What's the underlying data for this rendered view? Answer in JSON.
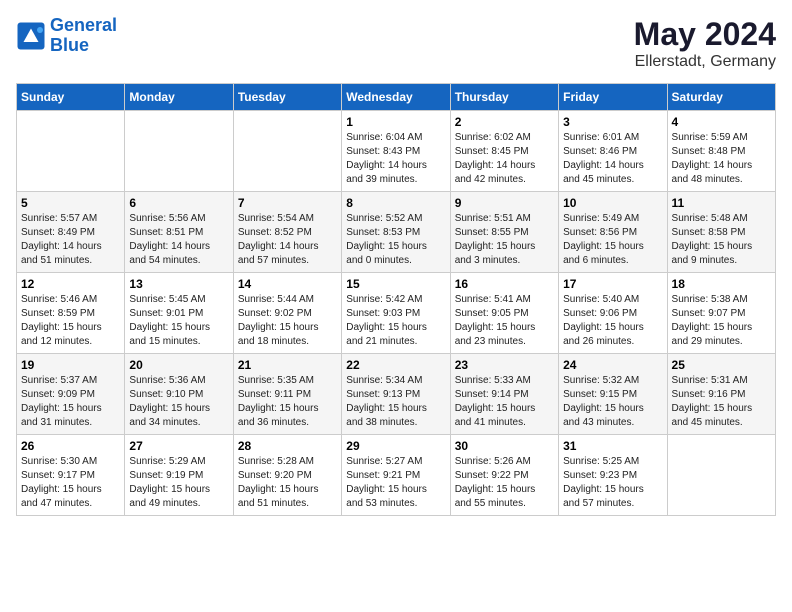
{
  "logo": {
    "line1": "General",
    "line2": "Blue"
  },
  "title": "May 2024",
  "subtitle": "Ellerstadt, Germany",
  "weekdays": [
    "Sunday",
    "Monday",
    "Tuesday",
    "Wednesday",
    "Thursday",
    "Friday",
    "Saturday"
  ],
  "weeks": [
    [
      {
        "day": "",
        "detail": ""
      },
      {
        "day": "",
        "detail": ""
      },
      {
        "day": "",
        "detail": ""
      },
      {
        "day": "1",
        "detail": "Sunrise: 6:04 AM\nSunset: 8:43 PM\nDaylight: 14 hours\nand 39 minutes."
      },
      {
        "day": "2",
        "detail": "Sunrise: 6:02 AM\nSunset: 8:45 PM\nDaylight: 14 hours\nand 42 minutes."
      },
      {
        "day": "3",
        "detail": "Sunrise: 6:01 AM\nSunset: 8:46 PM\nDaylight: 14 hours\nand 45 minutes."
      },
      {
        "day": "4",
        "detail": "Sunrise: 5:59 AM\nSunset: 8:48 PM\nDaylight: 14 hours\nand 48 minutes."
      }
    ],
    [
      {
        "day": "5",
        "detail": "Sunrise: 5:57 AM\nSunset: 8:49 PM\nDaylight: 14 hours\nand 51 minutes."
      },
      {
        "day": "6",
        "detail": "Sunrise: 5:56 AM\nSunset: 8:51 PM\nDaylight: 14 hours\nand 54 minutes."
      },
      {
        "day": "7",
        "detail": "Sunrise: 5:54 AM\nSunset: 8:52 PM\nDaylight: 14 hours\nand 57 minutes."
      },
      {
        "day": "8",
        "detail": "Sunrise: 5:52 AM\nSunset: 8:53 PM\nDaylight: 15 hours\nand 0 minutes."
      },
      {
        "day": "9",
        "detail": "Sunrise: 5:51 AM\nSunset: 8:55 PM\nDaylight: 15 hours\nand 3 minutes."
      },
      {
        "day": "10",
        "detail": "Sunrise: 5:49 AM\nSunset: 8:56 PM\nDaylight: 15 hours\nand 6 minutes."
      },
      {
        "day": "11",
        "detail": "Sunrise: 5:48 AM\nSunset: 8:58 PM\nDaylight: 15 hours\nand 9 minutes."
      }
    ],
    [
      {
        "day": "12",
        "detail": "Sunrise: 5:46 AM\nSunset: 8:59 PM\nDaylight: 15 hours\nand 12 minutes."
      },
      {
        "day": "13",
        "detail": "Sunrise: 5:45 AM\nSunset: 9:01 PM\nDaylight: 15 hours\nand 15 minutes."
      },
      {
        "day": "14",
        "detail": "Sunrise: 5:44 AM\nSunset: 9:02 PM\nDaylight: 15 hours\nand 18 minutes."
      },
      {
        "day": "15",
        "detail": "Sunrise: 5:42 AM\nSunset: 9:03 PM\nDaylight: 15 hours\nand 21 minutes."
      },
      {
        "day": "16",
        "detail": "Sunrise: 5:41 AM\nSunset: 9:05 PM\nDaylight: 15 hours\nand 23 minutes."
      },
      {
        "day": "17",
        "detail": "Sunrise: 5:40 AM\nSunset: 9:06 PM\nDaylight: 15 hours\nand 26 minutes."
      },
      {
        "day": "18",
        "detail": "Sunrise: 5:38 AM\nSunset: 9:07 PM\nDaylight: 15 hours\nand 29 minutes."
      }
    ],
    [
      {
        "day": "19",
        "detail": "Sunrise: 5:37 AM\nSunset: 9:09 PM\nDaylight: 15 hours\nand 31 minutes."
      },
      {
        "day": "20",
        "detail": "Sunrise: 5:36 AM\nSunset: 9:10 PM\nDaylight: 15 hours\nand 34 minutes."
      },
      {
        "day": "21",
        "detail": "Sunrise: 5:35 AM\nSunset: 9:11 PM\nDaylight: 15 hours\nand 36 minutes."
      },
      {
        "day": "22",
        "detail": "Sunrise: 5:34 AM\nSunset: 9:13 PM\nDaylight: 15 hours\nand 38 minutes."
      },
      {
        "day": "23",
        "detail": "Sunrise: 5:33 AM\nSunset: 9:14 PM\nDaylight: 15 hours\nand 41 minutes."
      },
      {
        "day": "24",
        "detail": "Sunrise: 5:32 AM\nSunset: 9:15 PM\nDaylight: 15 hours\nand 43 minutes."
      },
      {
        "day": "25",
        "detail": "Sunrise: 5:31 AM\nSunset: 9:16 PM\nDaylight: 15 hours\nand 45 minutes."
      }
    ],
    [
      {
        "day": "26",
        "detail": "Sunrise: 5:30 AM\nSunset: 9:17 PM\nDaylight: 15 hours\nand 47 minutes."
      },
      {
        "day": "27",
        "detail": "Sunrise: 5:29 AM\nSunset: 9:19 PM\nDaylight: 15 hours\nand 49 minutes."
      },
      {
        "day": "28",
        "detail": "Sunrise: 5:28 AM\nSunset: 9:20 PM\nDaylight: 15 hours\nand 51 minutes."
      },
      {
        "day": "29",
        "detail": "Sunrise: 5:27 AM\nSunset: 9:21 PM\nDaylight: 15 hours\nand 53 minutes."
      },
      {
        "day": "30",
        "detail": "Sunrise: 5:26 AM\nSunset: 9:22 PM\nDaylight: 15 hours\nand 55 minutes."
      },
      {
        "day": "31",
        "detail": "Sunrise: 5:25 AM\nSunset: 9:23 PM\nDaylight: 15 hours\nand 57 minutes."
      },
      {
        "day": "",
        "detail": ""
      }
    ]
  ]
}
